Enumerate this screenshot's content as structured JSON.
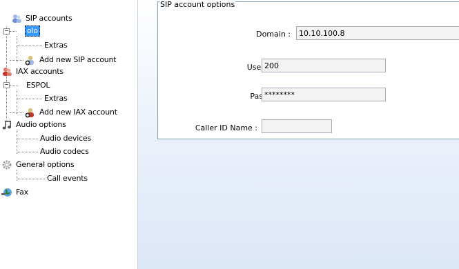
{
  "tree": {
    "sip_accounts": "SIP accounts",
    "sip_account_name": "olo",
    "sip_extras": "Extras",
    "add_sip": "Add new SIP account",
    "iax_accounts": "IAX accounts",
    "iax_account_name": "ESPOL",
    "iax_extras": "Extras",
    "add_iax": "Add new IAX account",
    "audio_options": "Audio options",
    "audio_devices": "Audio devices",
    "audio_codecs": "Audio codecs",
    "general_options": "General options",
    "call_events": "Call events",
    "fax": "Fax"
  },
  "panel": {
    "group_title": "SIP account options",
    "domain_label": "Domain :",
    "domain_value": "10.10.100.8",
    "username_label": "Username :",
    "username_value": "200",
    "password_label": "Password :",
    "password_value": "********",
    "callerid_label": "Caller ID Name :",
    "callerid_value": ""
  }
}
